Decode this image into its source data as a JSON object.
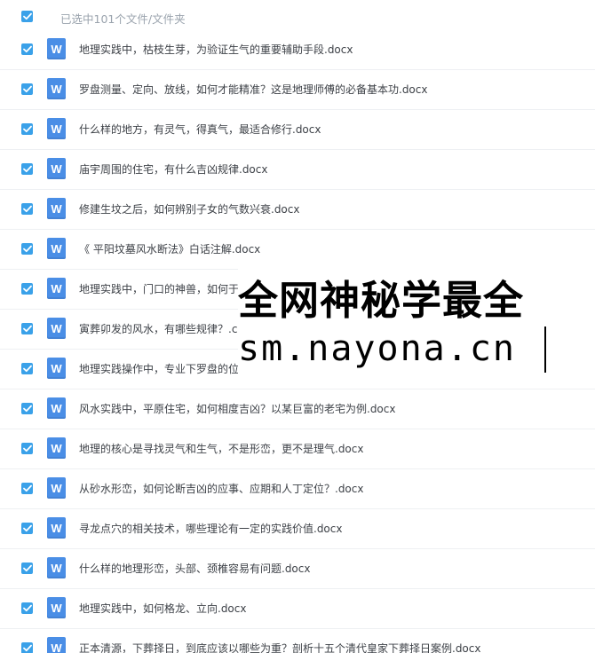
{
  "header": {
    "select_all_checked": true,
    "label": "已选中101个文件/文件夹"
  },
  "icons": {
    "file_type": "word-doc-icon",
    "file_type_glyph": "W",
    "checkbox": "checkmark-icon"
  },
  "colors": {
    "checkbox": "#3aa1e9",
    "word_icon": "#4a8ee6",
    "row_text": "#3d4147",
    "header_text": "#9aa3ad"
  },
  "files": [
    {
      "name": "地理实践中，枯枝生芽，为验证生气的重要辅助手段.docx",
      "checked": true
    },
    {
      "name": "罗盘测量、定向、放线，如何才能精准？这是地理师傅的必备基本功.docx",
      "checked": true
    },
    {
      "name": "什么样的地方，有灵气，得真气，最适合修行.docx",
      "checked": true
    },
    {
      "name": "庙宇周围的住宅，有什么吉凶规律.docx",
      "checked": true
    },
    {
      "name": "修建生坟之后，如何辨别子女的气数兴衰.docx",
      "checked": true
    },
    {
      "name": "《 平阳坟墓风水断法》白话注解.docx",
      "checked": true
    },
    {
      "name": "地理实践中，门口的神兽，如何于",
      "checked": true
    },
    {
      "name": "寅葬卯发的风水，有哪些规律？.c",
      "checked": true
    },
    {
      "name": "地理实践操作中，专业下罗盘的位",
      "checked": true
    },
    {
      "name": "风水实践中，平原住宅，如何相度吉凶？以某巨富的老宅为例.docx",
      "checked": true
    },
    {
      "name": "地理的核心是寻找灵气和生气，不是形峦，更不是理气.docx",
      "checked": true
    },
    {
      "name": "从砂水形峦，如何论断吉凶的应事、应期和人丁定位？.docx",
      "checked": true
    },
    {
      "name": "寻龙点穴的相关技术，哪些理论有一定的实践价值.docx",
      "checked": true
    },
    {
      "name": "什么样的地理形峦，头部、颈椎容易有问题.docx",
      "checked": true
    },
    {
      "name": "地理实践中，如何格龙、立向.docx",
      "checked": true
    },
    {
      "name": "正本清源，下葬择日，到底应该以哪些为重？剖析十五个清代皇家下葬择日案例.docx",
      "checked": true
    }
  ],
  "watermark": {
    "line1": "全网神秘学最全",
    "line2": "sm.nayona.cn"
  }
}
